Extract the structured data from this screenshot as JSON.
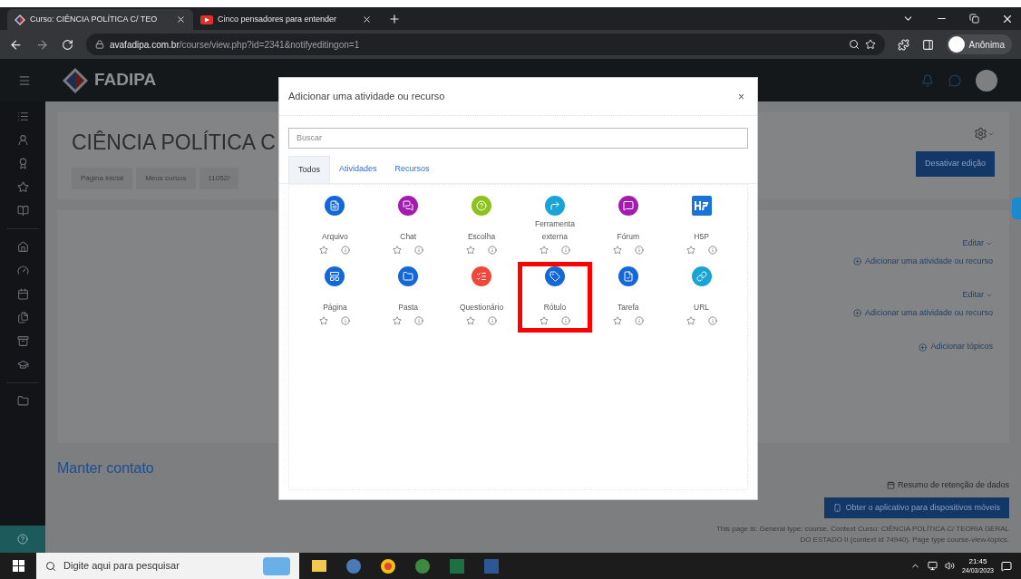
{
  "browser": {
    "tabs": [
      {
        "title": "Curso: CIÊNCIA POLÍTICA C/ TEO",
        "selected": true,
        "kind": "site"
      },
      {
        "title": "Cinco pensadores para entender",
        "selected": false,
        "kind": "video"
      }
    ],
    "url_host": "avafadipa.com.br",
    "url_path": "/course/view.php?id=2341&notifyeditingon=1",
    "profile": "Anônima"
  },
  "navbar": {
    "brand": "FADIPA"
  },
  "course": {
    "title": "CIÊNCIA POLÍTICA C",
    "breadcrumb": [
      "Página inicial",
      "Meus cursos",
      "11052/"
    ],
    "edit_button": "Desativar edição",
    "sections": [
      {
        "edit": "Editar",
        "add": "Adicionar uma atividade ou recurso"
      },
      {
        "edit": "Editar",
        "add": "Adicionar uma atividade ou recurso"
      }
    ],
    "add_topics": "Adicionar tópicos"
  },
  "footer": {
    "contact": "Manter contato",
    "retention": "Resumo de retenção de dados",
    "app_button": "Obter o aplicativo para dispositivos móveis",
    "info_1": "This page is: General type: course. Context Curso: CIÊNCIA POLÍTICA C/ TEORIA GERAL",
    "info_2": "DO ESTADO II (context id 74940). Page type course-view-topics."
  },
  "modal": {
    "title": "Adicionar uma atividade ou recurso",
    "close": "×",
    "search_placeholder": "Buscar",
    "tabs": [
      {
        "label": "Todos",
        "selected": true
      },
      {
        "label": "Atividades",
        "selected": false
      },
      {
        "label": "Recursos",
        "selected": false
      }
    ],
    "items": [
      {
        "name": "Arquivo",
        "kind": "file",
        "color": "#1467d6",
        "highlighted": false
      },
      {
        "name": "Chat",
        "kind": "chat",
        "color": "#a21caf",
        "highlighted": false
      },
      {
        "name": "Escolha",
        "kind": "choice",
        "color": "#8cc21a",
        "highlighted": false
      },
      {
        "name": "Ferramenta externa",
        "kind": "external",
        "color": "#1aa3d6",
        "highlighted": false
      },
      {
        "name": "Fórum",
        "kind": "forum",
        "color": "#a21caf",
        "highlighted": false
      },
      {
        "name": "H5P",
        "kind": "h5p",
        "color": "#1a73d6",
        "highlighted": false
      },
      {
        "name": "Página",
        "kind": "page",
        "color": "#1467d6",
        "highlighted": false
      },
      {
        "name": "Pasta",
        "kind": "folder",
        "color": "#1467d6",
        "highlighted": false
      },
      {
        "name": "Questionário",
        "kind": "quiz",
        "color": "#f0473a",
        "highlighted": false
      },
      {
        "name": "Rótulo",
        "kind": "label",
        "color": "#1467d6",
        "highlighted": true
      },
      {
        "name": "Tarefa",
        "kind": "assign",
        "color": "#1467d6",
        "highlighted": false
      },
      {
        "name": "URL",
        "kind": "url",
        "color": "#1aa3d6",
        "highlighted": false
      }
    ]
  },
  "taskbar": {
    "search_placeholder": "Digite aqui para pesquisar",
    "time": "21:45",
    "date": "24/03/2023"
  }
}
